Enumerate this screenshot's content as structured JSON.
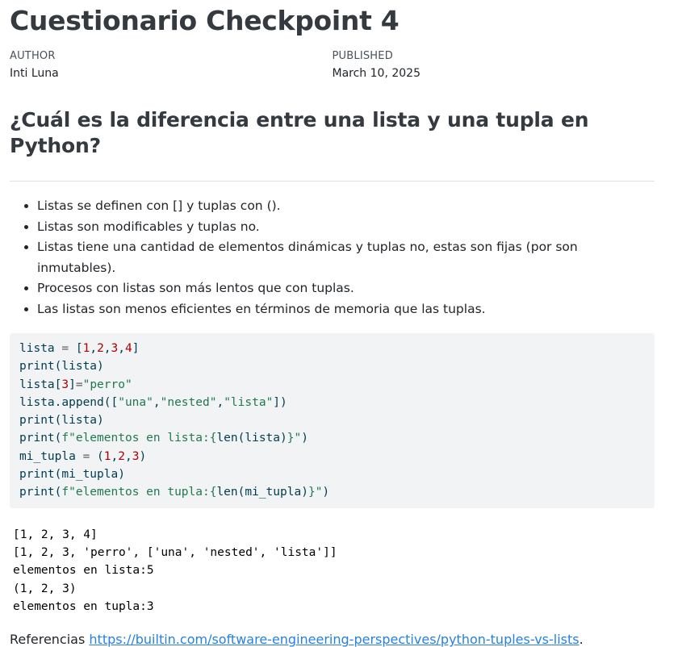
{
  "title": "Cuestionario Checkpoint 4",
  "meta": {
    "author_heading": "AUTHOR",
    "author": "Inti Luna",
    "published_heading": "PUBLISHED",
    "published": "March 10, 2025"
  },
  "question": "¿Cuál es la diferencia entre una lista y una tupla en Python?",
  "points": [
    "Listas se definen con [] y tuplas con ().",
    "Listas son modificables y tuplas no.",
    "Listas tiene una cantidad de elementos dinámicas y tuplas no, estas son fijas (por son inmutables).",
    "Procesos con listas son más lentos que con tuplas.",
    "Las listas son menos eficientes en términos de memoria que las tuplas."
  ],
  "code": {
    "line1": {
      "a": "lista ",
      "b": "=",
      "c": " [",
      "n1": "1",
      "s1": ",",
      "n2": "2",
      "s2": ",",
      "n3": "3",
      "s3": ",",
      "n4": "4",
      "d": "]"
    },
    "line2": "print(lista)",
    "line3": {
      "a": "lista[",
      "n": "3",
      "b": "]",
      "op": "=",
      "str": "\"perro\""
    },
    "line4": {
      "a": "lista.append([",
      "s1": "\"una\"",
      "c1": ",",
      "s2": "\"nested\"",
      "c2": ",",
      "s3": "\"lista\"",
      "b": "])"
    },
    "line5": "print(lista)",
    "line6": {
      "a": "print(",
      "s1": "f\"elementos en lista:",
      "b": "{",
      "c": "len(lista)",
      "d": "}",
      "s2": "\"",
      "e": ")"
    },
    "line7": {
      "a": "mi_tupla ",
      "op": "=",
      "b": " (",
      "n1": "1",
      "c1": ",",
      "n2": "2",
      "c2": ",",
      "n3": "3",
      "d": ")"
    },
    "line8": "print(mi_tupla)",
    "line9": {
      "a": "print(",
      "s1": "f\"elementos en tupla:",
      "b": "{",
      "c": "len(mi_tupla)",
      "d": "}",
      "s2": "\"",
      "e": ")"
    }
  },
  "output": [
    "[1, 2, 3, 4]",
    "[1, 2, 3, 'perro', ['una', 'nested', 'lista']]",
    "elementos en lista:5",
    "(1, 2, 3)",
    "elementos en tupla:3"
  ],
  "references": {
    "label": "Referencias ",
    "link_text": "https://builtin.com/software-engineering-perspectives/python-tuples-vs-lists",
    "after": "."
  }
}
